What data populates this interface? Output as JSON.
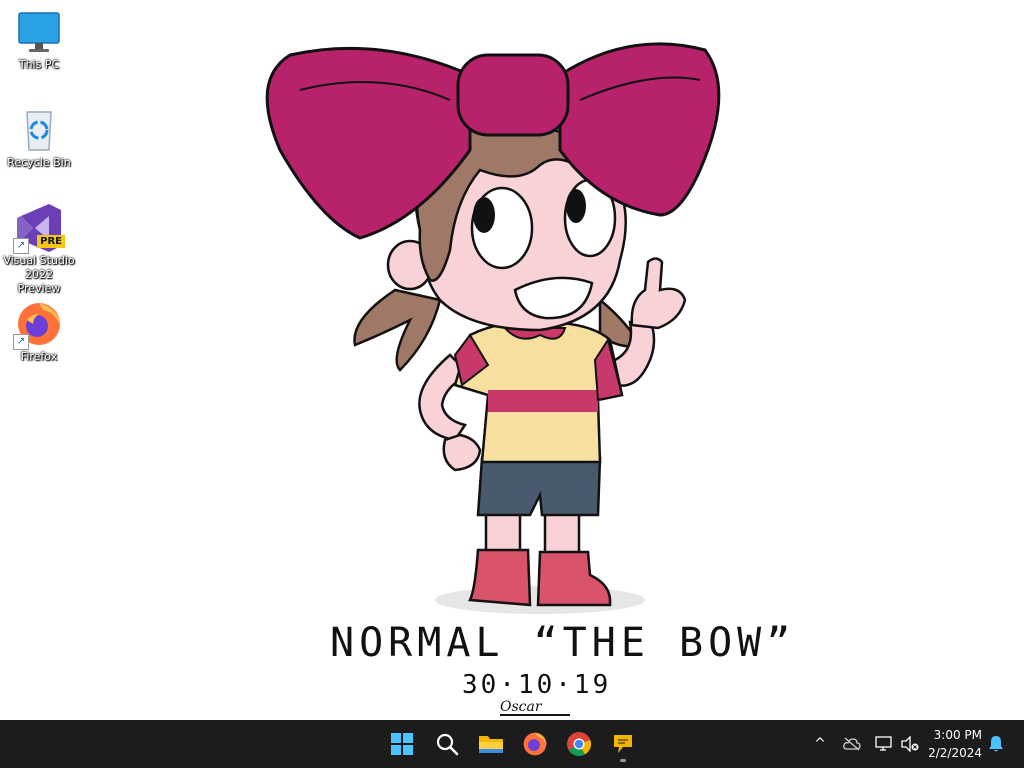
{
  "desktop": {
    "icons": [
      {
        "label": "This PC",
        "icon": "monitor-icon"
      },
      {
        "label": "Recycle Bin",
        "icon": "recycle-bin-icon"
      },
      {
        "label": "Visual Studio 2022 Preview",
        "icon": "visual-studio-icon",
        "badge": "PRE"
      },
      {
        "label": "Firefox",
        "icon": "firefox-icon"
      }
    ]
  },
  "wallpaper": {
    "caption": "NORMAL “THE BOW”",
    "date": "30·10·19",
    "signature": "Oscar"
  },
  "taskbar": {
    "buttons": [
      {
        "name": "start",
        "icon": "windows-start-icon"
      },
      {
        "name": "search",
        "icon": "search-icon"
      },
      {
        "name": "file-explorer",
        "icon": "folder-icon"
      },
      {
        "name": "firefox",
        "icon": "firefox-icon"
      },
      {
        "name": "chrome",
        "icon": "chrome-icon"
      },
      {
        "name": "chat",
        "icon": "chat-bubble-icon",
        "active": true
      }
    ],
    "tray": {
      "chevron": "^",
      "time": "3:00 PM",
      "date": "2/2/2024"
    }
  },
  "colors": {
    "taskbar": "#1c1c1c",
    "bow": "#b8226a",
    "skin": "#f8d2d6",
    "shirt": "#f7dfa0",
    "shorts": "#4a5a6e",
    "hair": "#a07868",
    "boots": "#d9536a"
  }
}
